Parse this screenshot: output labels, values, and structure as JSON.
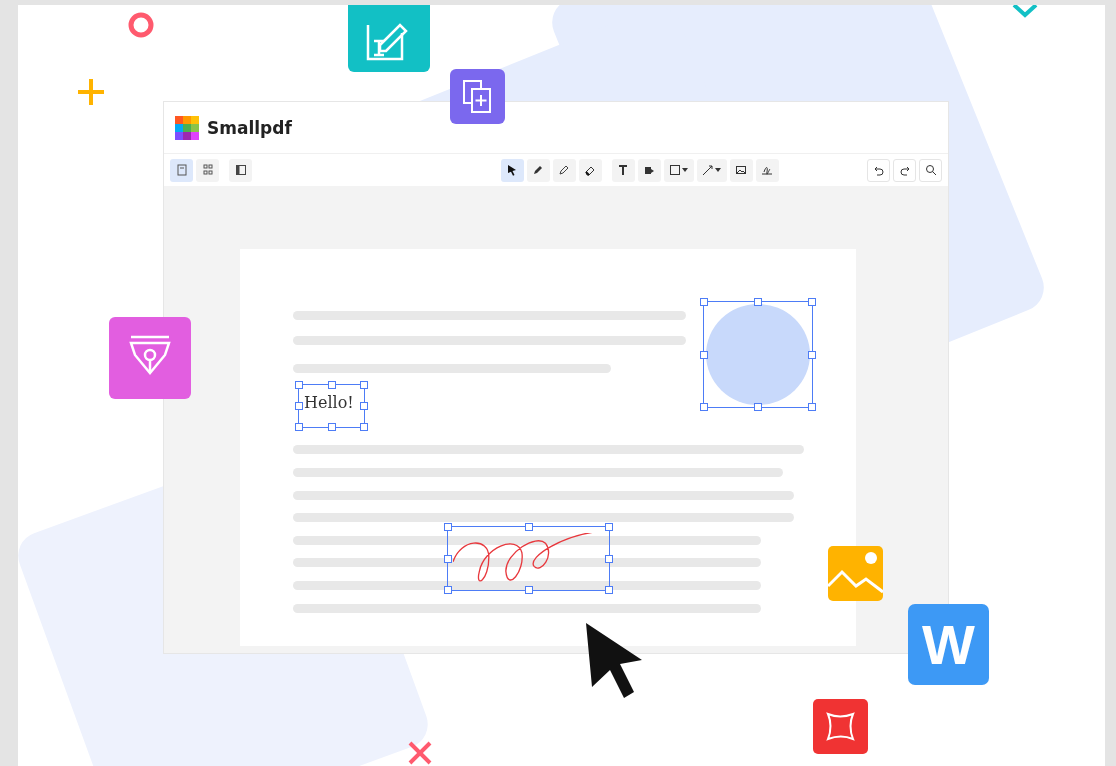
{
  "app": {
    "name": "Smallpdf"
  },
  "toolbar": {
    "left": [
      {
        "kind": "page-view",
        "selected": true
      },
      {
        "kind": "grid-view",
        "selected": false
      },
      {
        "kind": "sidebar",
        "selected": false
      }
    ],
    "tools": [
      {
        "kind": "select",
        "selected": true
      },
      {
        "kind": "pen",
        "selected": false
      },
      {
        "kind": "highlighter",
        "selected": false
      },
      {
        "kind": "eraser",
        "selected": false
      },
      {
        "kind": "text",
        "selected": false
      },
      {
        "kind": "stamp",
        "selected": false
      },
      {
        "kind": "shape",
        "selected": false
      },
      {
        "kind": "line",
        "selected": false
      },
      {
        "kind": "image",
        "selected": false
      },
      {
        "kind": "sign",
        "selected": false
      }
    ],
    "right": [
      {
        "kind": "undo"
      },
      {
        "kind": "redo"
      },
      {
        "kind": "search"
      }
    ]
  },
  "document": {
    "text_annotation": "Hello!"
  },
  "word_badge": "W"
}
